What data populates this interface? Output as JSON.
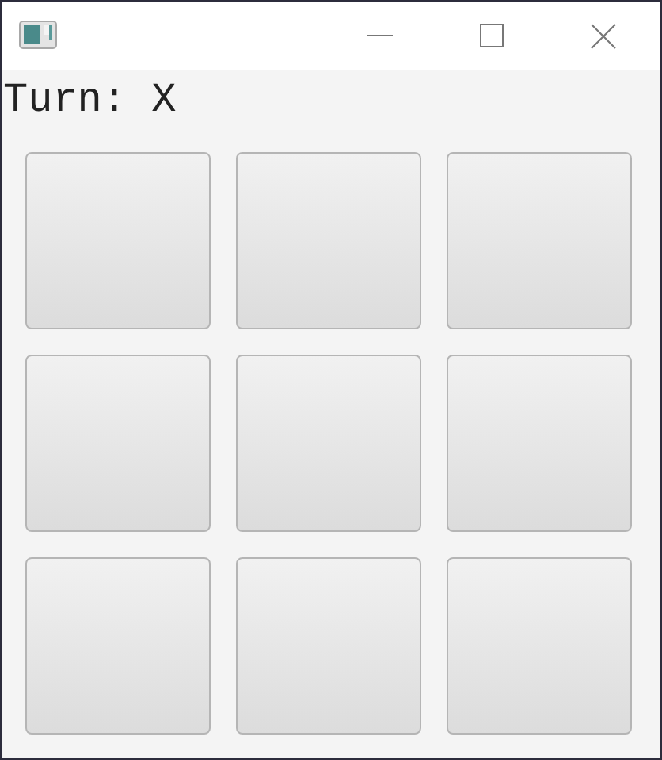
{
  "status_label": "Turn: X",
  "board": {
    "cells": [
      {
        "kind": "button"
      },
      {
        "kind": "button"
      },
      {
        "kind": "button"
      },
      {
        "kind": "button"
      },
      {
        "kind": "button"
      },
      {
        "kind": "button"
      },
      {
        "kind": "button"
      },
      {
        "kind": "button"
      },
      {
        "kind": "button"
      }
    ]
  }
}
